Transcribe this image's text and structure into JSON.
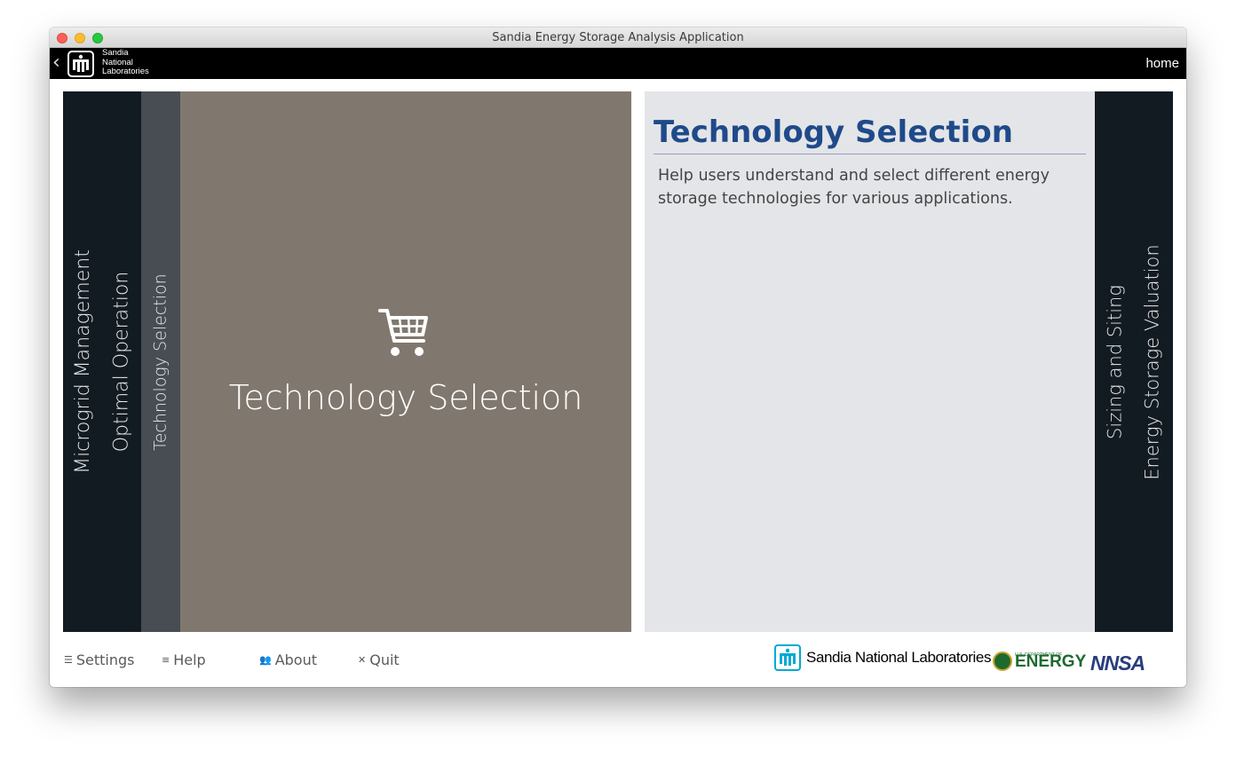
{
  "window": {
    "title": "Sandia Energy Storage Analysis Application"
  },
  "appbar": {
    "logo_lines": [
      "Sandia",
      "National",
      "Laboratories"
    ],
    "home_label": "home"
  },
  "left_tabs": [
    {
      "label": "Microgrid Management"
    },
    {
      "label": "Optimal Operation"
    },
    {
      "label": "Technology Selection",
      "active": true
    }
  ],
  "feature": {
    "title": "Technology Selection",
    "icon": "shopping-cart-icon"
  },
  "description": {
    "title": "Technology Selection",
    "text": "Help users understand and select different energy storage technologies for various applications."
  },
  "right_tabs": [
    {
      "label": "Sizing and Siting"
    },
    {
      "label": "Energy Storage Valuation"
    }
  ],
  "footer": {
    "links": [
      {
        "label": "Settings",
        "icon": "list-icon"
      },
      {
        "label": "Help",
        "icon": "menu-icon"
      },
      {
        "label": "About",
        "icon": "users-icon"
      },
      {
        "label": "Quit",
        "icon": "close-icon"
      }
    ],
    "logos": {
      "sandia": "Sandia National Laboratories",
      "doe_small": "U.S. DEPARTMENT OF",
      "doe": "ENERGY",
      "nnsa": "NNSA"
    }
  },
  "colors": {
    "feature_bg": "#80786f",
    "tab_dark": "#131b22",
    "tab_active": "#474d52",
    "desc_bg": "#e4e5e8",
    "title_blue": "#1f4a8a"
  }
}
